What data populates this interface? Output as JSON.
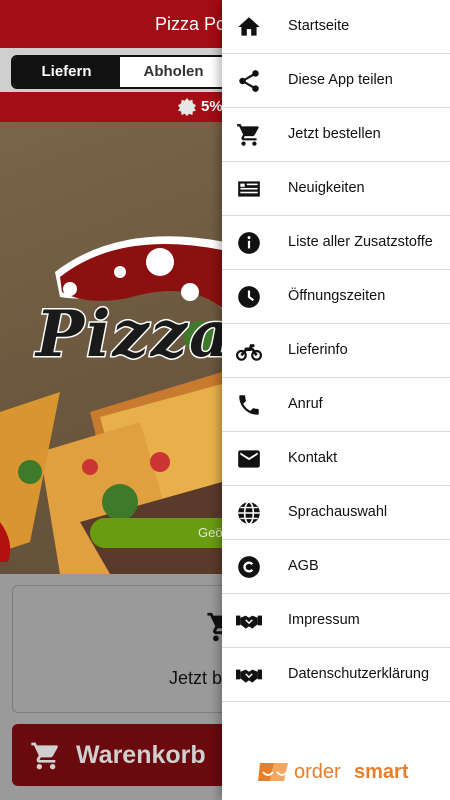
{
  "header": {
    "title_partial": "Pizza Po"
  },
  "mode_tabs": [
    {
      "label": "Liefern",
      "active": true
    },
    {
      "label": "Abholen",
      "active": false
    }
  ],
  "promo": {
    "text_partial": "5%"
  },
  "hero": {
    "logo_word": "Pizza",
    "status_partial": "Geö"
  },
  "order_card": {
    "label_partial": "Jetzt b"
  },
  "basket": {
    "label_partial": "Warenkorb"
  },
  "drawer": {
    "items": [
      {
        "label": "Startseite",
        "icon": "home-icon"
      },
      {
        "label": "Diese App teilen",
        "icon": "share-icon"
      },
      {
        "label": "Jetzt bestellen",
        "icon": "cart-icon"
      },
      {
        "label": "Neuigkeiten",
        "icon": "news-icon"
      },
      {
        "label": "Liste aller Zusatzstoffe",
        "icon": "info-icon"
      },
      {
        "label": "Öffnungszeiten",
        "icon": "clock-icon"
      },
      {
        "label": "Lieferinfo",
        "icon": "motorcycle-icon"
      },
      {
        "label": "Anruf",
        "icon": "phone-icon"
      },
      {
        "label": "Kontakt",
        "icon": "mail-icon"
      },
      {
        "label": "Sprachauswahl",
        "icon": "globe-icon"
      },
      {
        "label": "AGB",
        "icon": "copyright-icon"
      },
      {
        "label": "Impressum",
        "icon": "handshake-icon"
      },
      {
        "label": "Datenschutzerklärung",
        "icon": "handshake-icon"
      }
    ],
    "brand": {
      "word1": "order",
      "word2": "smart"
    }
  },
  "colors": {
    "primary": "#a30d16",
    "accent": "#e87e2a",
    "status": "#6a9c12"
  }
}
